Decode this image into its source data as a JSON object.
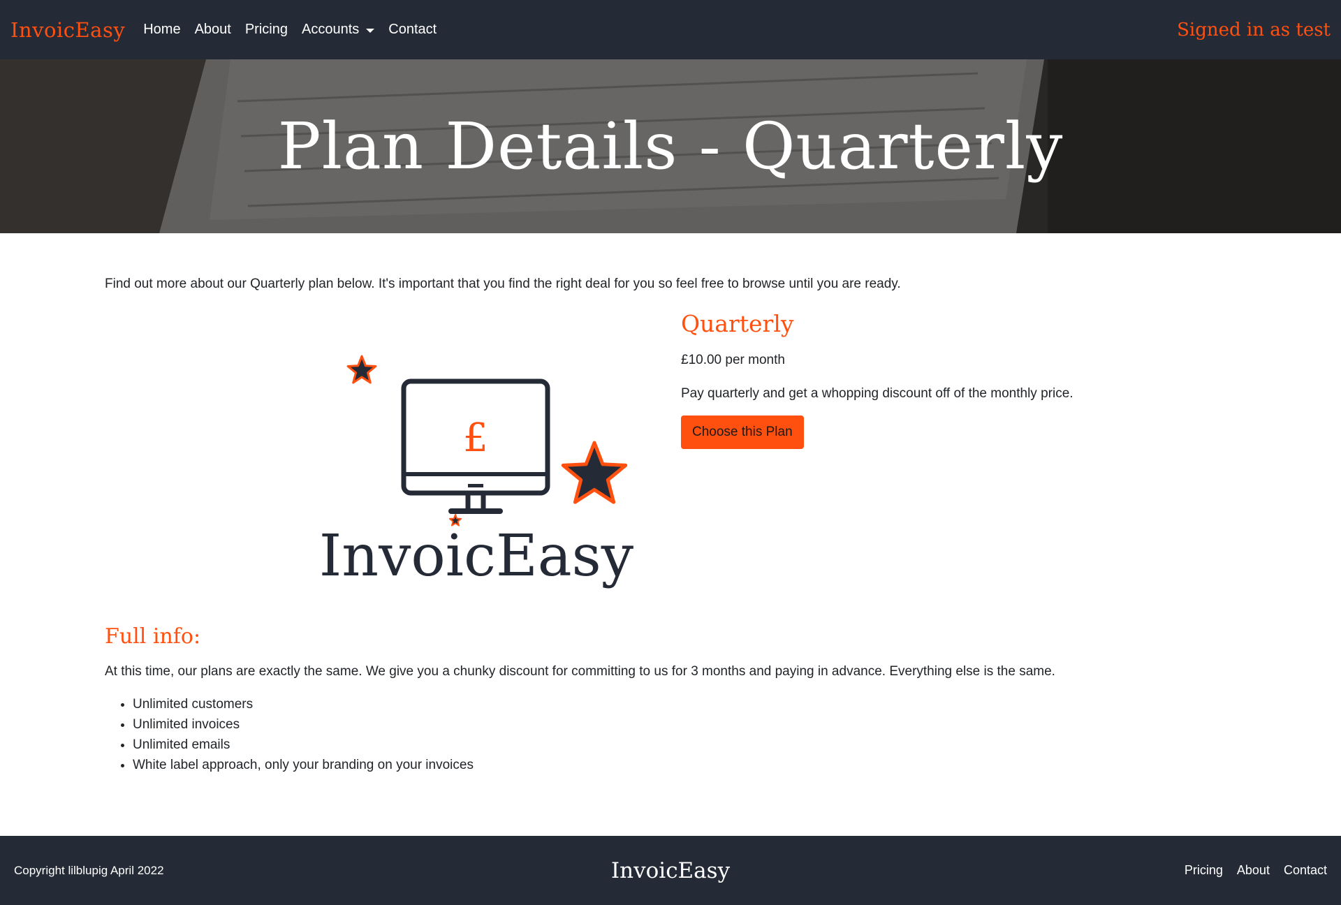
{
  "navbar": {
    "brand": "InvoicEasy",
    "links": [
      "Home",
      "About",
      "Pricing",
      "Accounts",
      "Contact"
    ],
    "signed_in": "Signed in as test"
  },
  "hero": {
    "title": "Plan Details - Quarterly"
  },
  "intro": "Find out more about our Quarterly plan below. It's important that you find the right deal for you so feel free to browse until you are ready.",
  "logo": {
    "wordmark": "InvoicEasy",
    "currency_symbol": "£"
  },
  "plan": {
    "name": "Quarterly",
    "price": "£10.00 per month",
    "description": "Pay quarterly and get a whopping discount off of the monthly price.",
    "button": "Choose this Plan"
  },
  "full_info": {
    "title": "Full info:",
    "text": "At this time, our plans are exactly the same. We give you a chunky discount for committing to us for 3 months and paying in advance. Everything else is the same.",
    "features": [
      "Unlimited customers",
      "Unlimited invoices",
      "Unlimited emails",
      "White label approach, only your branding on your invoices"
    ]
  },
  "footer": {
    "copyright": "Copyright lilblupig April 2022",
    "brand": "InvoicEasy",
    "links": [
      "Pricing",
      "About",
      "Contact"
    ]
  },
  "colors": {
    "accent": "#ff5010",
    "dark": "#252b36"
  }
}
